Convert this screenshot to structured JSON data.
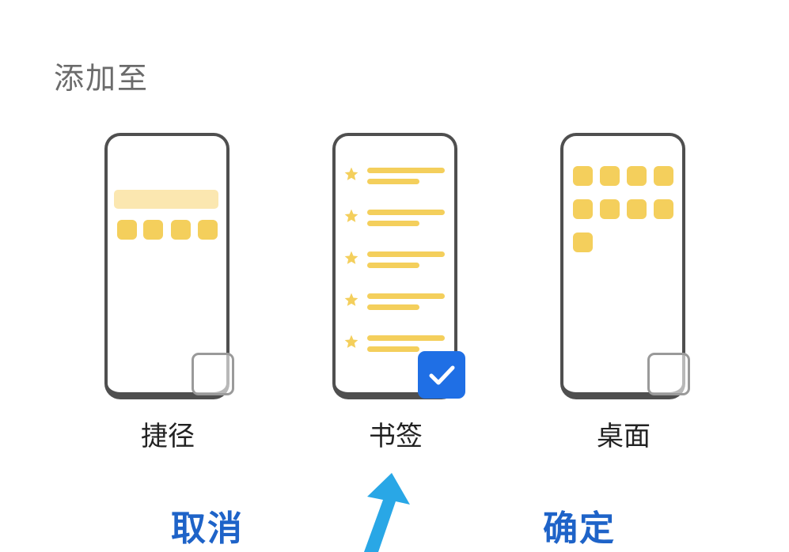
{
  "dialog": {
    "title": "添加至"
  },
  "options": [
    {
      "label": "捷径",
      "checked": false,
      "icon": "shortcut-preview"
    },
    {
      "label": "书签",
      "checked": true,
      "icon": "bookmark-preview"
    },
    {
      "label": "桌面",
      "checked": false,
      "icon": "desktop-preview"
    }
  ],
  "actions": {
    "cancel_label": "取消",
    "confirm_label": "确定"
  },
  "colors": {
    "accent": "#1e63c8",
    "check_fill": "#1f6fe5",
    "preview_yellow": "#f4cf5c",
    "preview_yellow_light": "#fbe7b0",
    "arrow": "#29a7e6"
  },
  "icons": {
    "selected_check": "checkmark-icon",
    "annotation": "pointer-arrow-icon"
  }
}
